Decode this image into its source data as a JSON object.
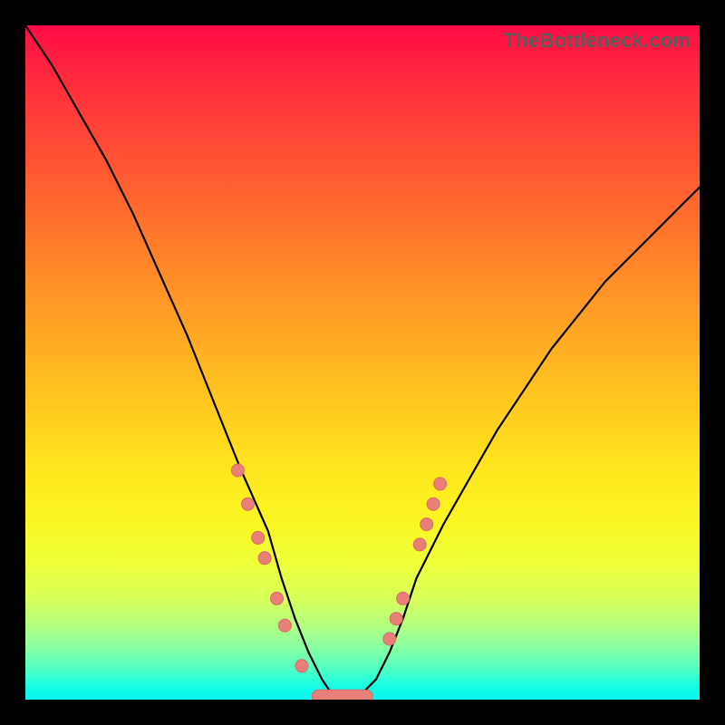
{
  "watermark": "TheBottleneck.com",
  "chart_data": {
    "type": "line",
    "title": "",
    "xlabel": "",
    "ylabel": "",
    "xlim": [
      0,
      100
    ],
    "ylim": [
      0,
      100
    ],
    "grid": false,
    "legend": false,
    "description": "V-shaped bottleneck curve over red-to-green vertical gradient; minimum (green) near x≈46, rising toward both edges.",
    "series": [
      {
        "name": "curve",
        "x": [
          0,
          4,
          8,
          12,
          16,
          20,
          24,
          28,
          32,
          36,
          38,
          40,
          42,
          44,
          46,
          48,
          50,
          52,
          54,
          56,
          58,
          62,
          66,
          70,
          74,
          78,
          82,
          86,
          90,
          94,
          98,
          100
        ],
        "y": [
          100,
          94,
          87,
          80,
          72,
          63,
          54,
          44,
          34,
          25,
          18,
          12,
          7,
          3,
          0,
          0,
          1,
          3,
          7,
          12,
          18,
          26,
          33,
          40,
          46,
          52,
          57,
          62,
          66,
          70,
          74,
          76
        ]
      }
    ],
    "markers_left": [
      {
        "x": 31.5,
        "y": 34
      },
      {
        "x": 33.0,
        "y": 29
      },
      {
        "x": 34.5,
        "y": 24
      },
      {
        "x": 35.5,
        "y": 21
      },
      {
        "x": 37.3,
        "y": 15
      },
      {
        "x": 38.5,
        "y": 11
      },
      {
        "x": 41.0,
        "y": 5
      }
    ],
    "markers_right": [
      {
        "x": 54.0,
        "y": 9
      },
      {
        "x": 55.0,
        "y": 12
      },
      {
        "x": 56.0,
        "y": 15
      },
      {
        "x": 58.5,
        "y": 23
      },
      {
        "x": 59.5,
        "y": 26
      },
      {
        "x": 60.5,
        "y": 29
      },
      {
        "x": 61.5,
        "y": 32
      }
    ],
    "flat_segment": {
      "x_start": 42.5,
      "x_end": 51.5,
      "y": 0.5
    },
    "colors": {
      "curve": "#000000",
      "markers": "#e87f78",
      "gradient_top": "#ff0b46",
      "gradient_bottom": "#0cf3f0"
    }
  }
}
